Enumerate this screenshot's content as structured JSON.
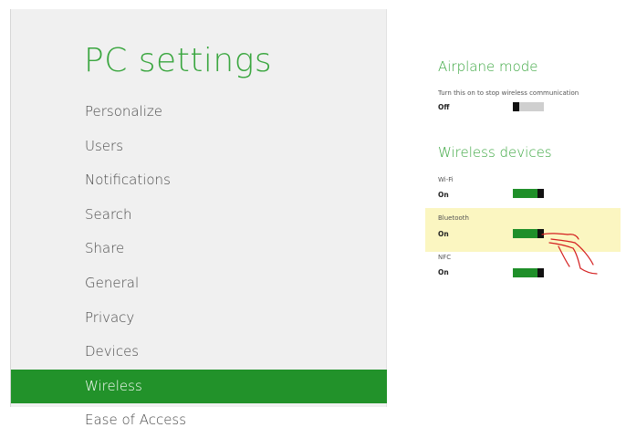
{
  "title": "PC settings",
  "nav": [
    {
      "label": "Personalize",
      "selected": false
    },
    {
      "label": "Users",
      "selected": false
    },
    {
      "label": "Notifications",
      "selected": false
    },
    {
      "label": "Search",
      "selected": false
    },
    {
      "label": "Share",
      "selected": false
    },
    {
      "label": "General",
      "selected": false
    },
    {
      "label": "Privacy",
      "selected": false
    },
    {
      "label": "Devices",
      "selected": false
    },
    {
      "label": "Wireless",
      "selected": true
    },
    {
      "label": "Ease of Access",
      "selected": false
    }
  ],
  "airplane": {
    "heading": "Airplane mode",
    "description": "Turn this on to stop wireless communication",
    "state": "Off",
    "toggle_on": false
  },
  "wireless": {
    "heading": "Wireless devices",
    "devices": [
      {
        "label": "Wi-Fi",
        "state": "On",
        "toggle_on": true
      },
      {
        "label": "Bluetooth",
        "state": "On",
        "toggle_on": true,
        "highlighted": true
      },
      {
        "label": "NFC",
        "state": "On",
        "toggle_on": true
      }
    ]
  },
  "colors": {
    "accent": "#3aa63f",
    "selected_bg": "#22922a",
    "toggle_on": "#1f8f29",
    "toggle_off": "#cfcfcf",
    "highlight": "#fbf6c1",
    "annotation": "#d42020"
  },
  "icons": {
    "annotation": "hand-pointer-icon"
  }
}
